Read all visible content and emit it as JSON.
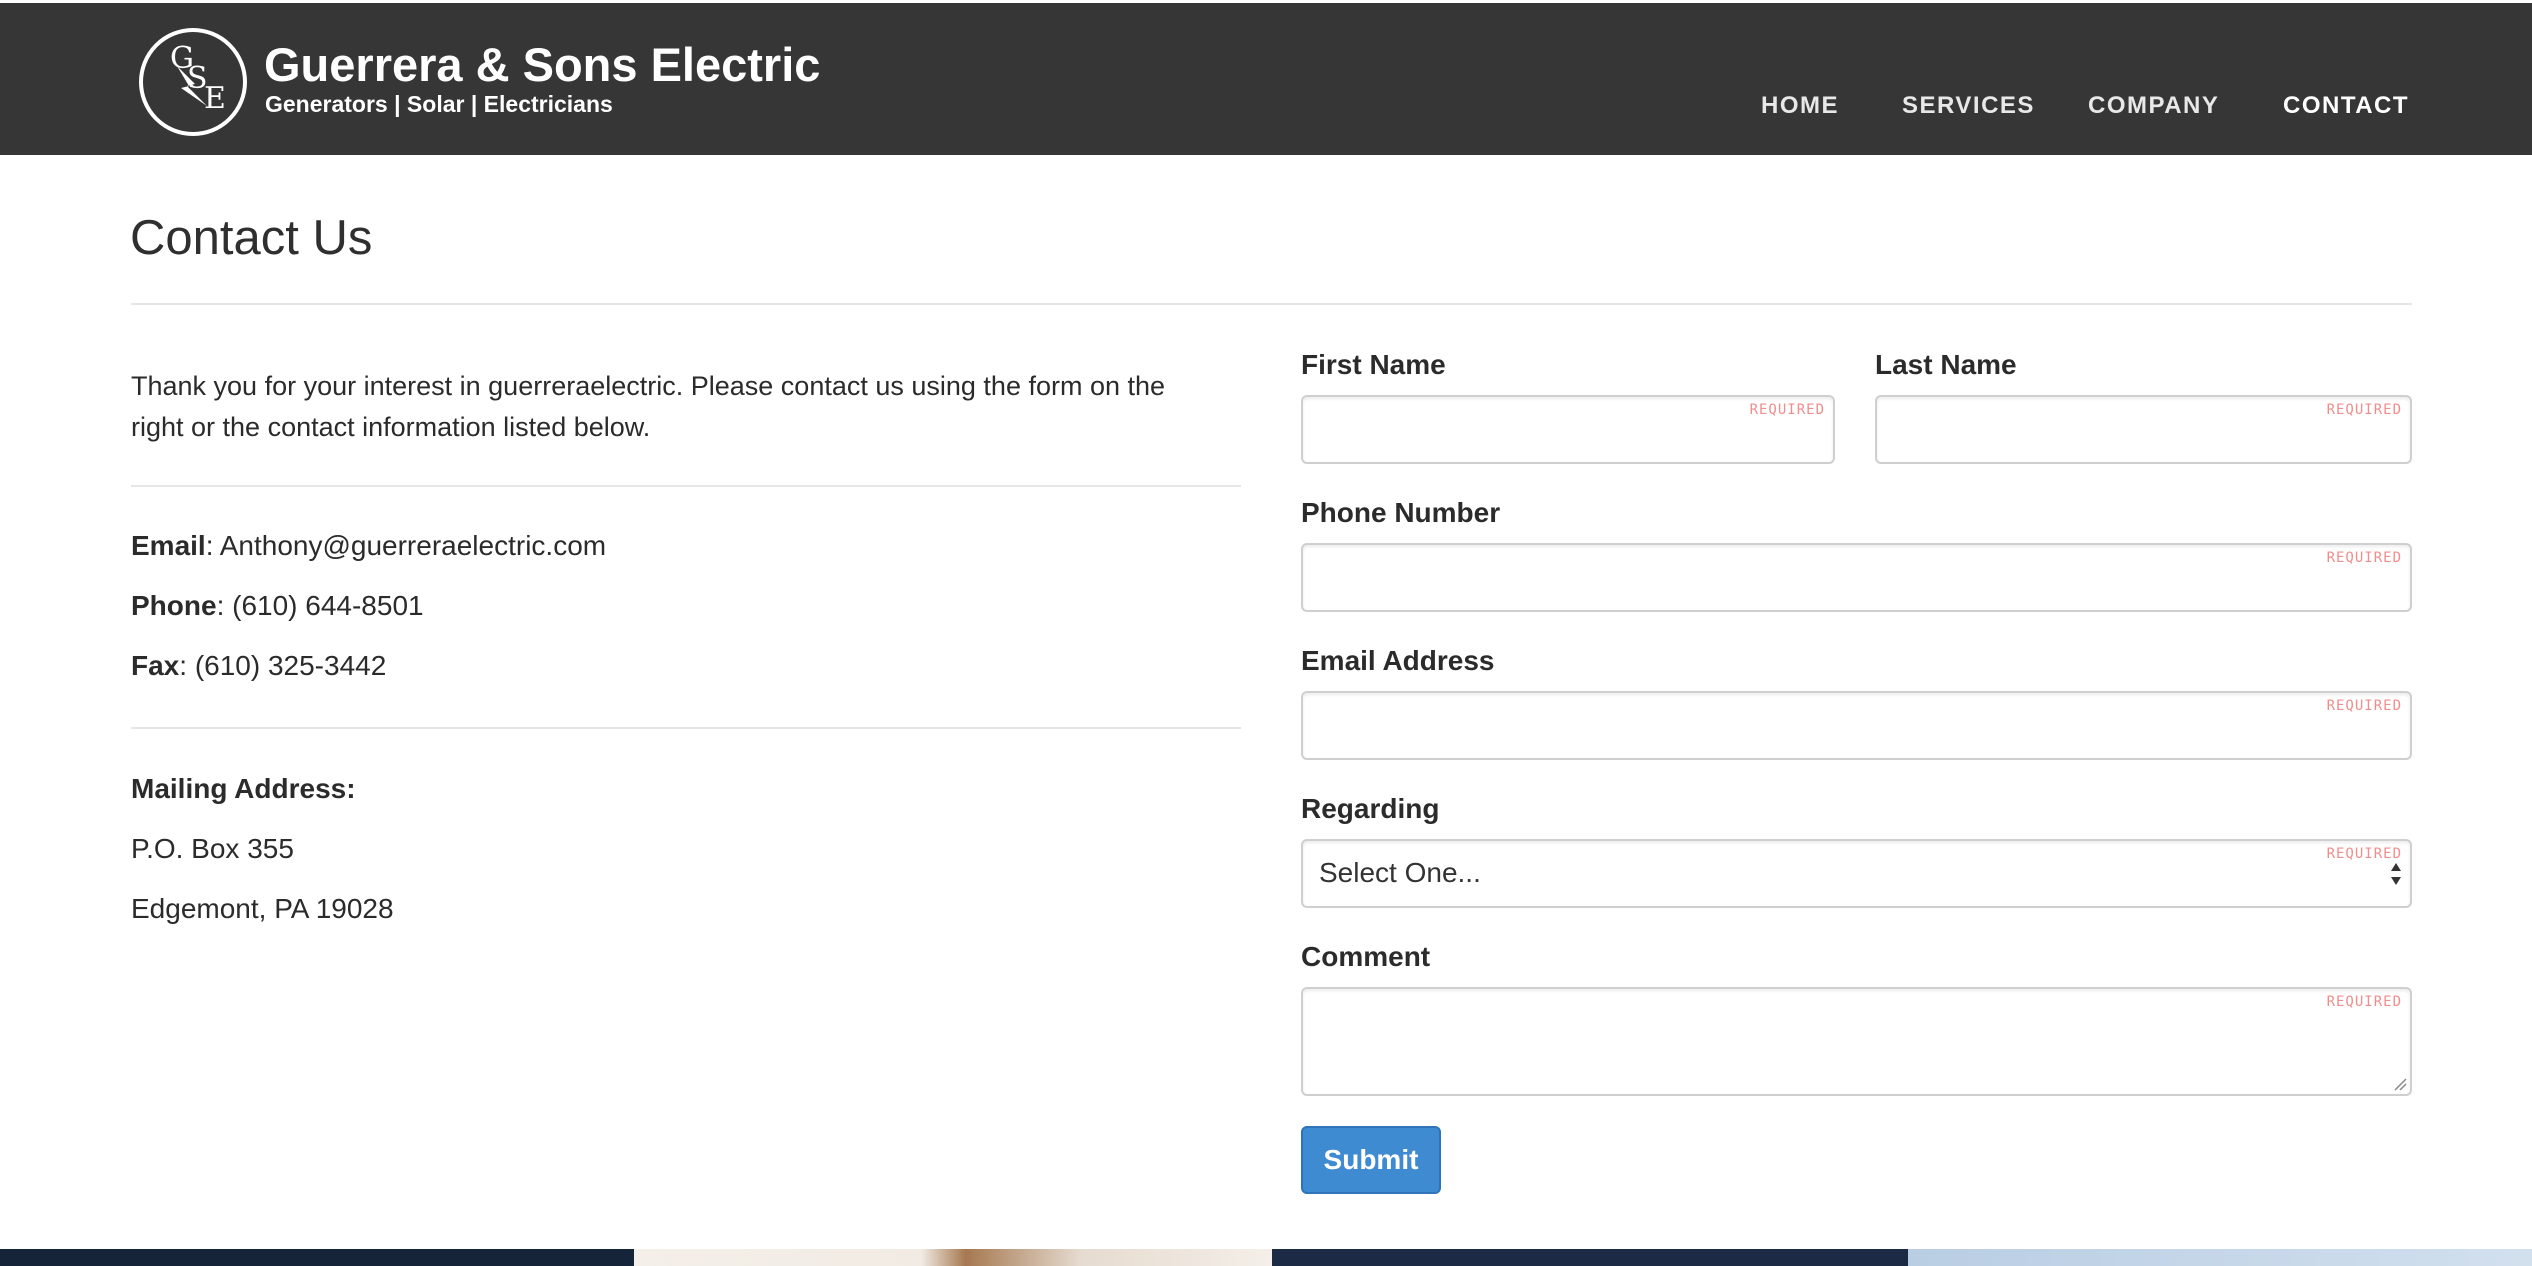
{
  "brand": {
    "logo_letters": [
      "G",
      "S",
      "E"
    ],
    "name": "Guerrera & Sons Electric",
    "tagline": "Generators | Solar | Electricians"
  },
  "nav": {
    "items": [
      {
        "label": "HOME"
      },
      {
        "label": "SERVICES"
      },
      {
        "label": "COMPANY"
      },
      {
        "label": "CONTACT",
        "active": true
      }
    ]
  },
  "page": {
    "title": "Contact Us",
    "intro": "Thank you for your interest in guerreraelectric. Please contact us using the form on the right or the contact information listed below."
  },
  "contact": {
    "email_label": "Email",
    "email": "Anthony@guerreraelectric.com",
    "phone_label": "Phone",
    "phone": "(610) 644-8501",
    "fax_label": "Fax",
    "fax": "(610) 325-3442",
    "mailing_label": "Mailing Address:",
    "address_line1": "P.O. Box 355",
    "address_line2": "Edgemont, PA 19028"
  },
  "form": {
    "required_tag": "REQUIRED",
    "first_name": {
      "label": "First Name",
      "value": ""
    },
    "last_name": {
      "label": "Last Name",
      "value": ""
    },
    "phone": {
      "label": "Phone Number",
      "value": ""
    },
    "email": {
      "label": "Email Address",
      "value": ""
    },
    "regarding": {
      "label": "Regarding",
      "selected": "Select One..."
    },
    "comment": {
      "label": "Comment",
      "value": ""
    },
    "submit_label": "Submit"
  },
  "colors": {
    "header_bg": "#363636",
    "required_text": "#f08d8d",
    "submit_bg": "#3f8bd2"
  },
  "icons": {
    "logo": "lightning-bolt-icon",
    "select": "up-down-arrows-icon",
    "resize": "resize-grip-icon"
  }
}
